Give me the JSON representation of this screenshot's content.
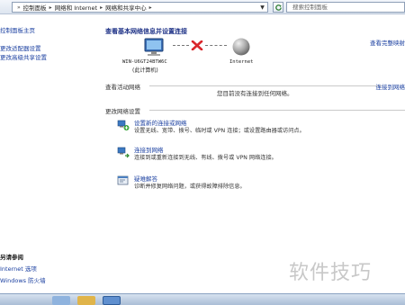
{
  "address_bar": {
    "crumbs": [
      "控制面板",
      "网络和 Internet",
      "网络和共享中心"
    ],
    "search_placeholder": "搜索控制面板"
  },
  "left_pane": {
    "links": [
      "控制面板主页",
      "更改适配器设置",
      "更改高级共享设置"
    ],
    "see_also_title": "另请参阅",
    "see_also_links": [
      "Internet 选项",
      "Windows 防火墙"
    ]
  },
  "main": {
    "title": "查看基本网络信息并设置连接",
    "full_map_link": "查看完整映射",
    "computer_name": "WIN-U6GT24BTW6C",
    "computer_sub": "(此计算机)",
    "network_name": "Internet",
    "active_networks_label": "查看活动网络",
    "connect_link": "连接到网络",
    "no_connection_text": "您目前没有连接到任何网络。",
    "change_settings_label": "更改网络设置",
    "tasks": [
      {
        "icon": "network-setup-icon",
        "title": "设置新的连接或网络",
        "desc": "设置无线、宽带、拨号、临时或 VPN 连接；或设置路由器或访问点。"
      },
      {
        "icon": "connect-network-icon",
        "title": "连接到网络",
        "desc": "连接到或重新连接到无线、有线、拨号或 VPN 网络连接。"
      },
      {
        "icon": "troubleshoot-icon",
        "title": "疑难解答",
        "desc": "诊断并修复网络问题，或获得故障排除信息。"
      }
    ]
  },
  "watermark_text": "软件技巧"
}
